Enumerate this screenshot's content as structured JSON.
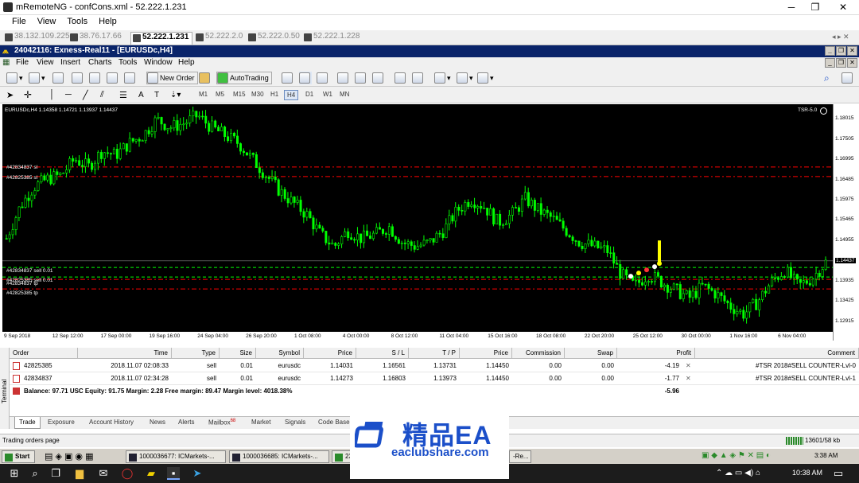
{
  "outer_window": {
    "title": "mRemoteNG - confCons.xml - 52.222.1.231",
    "menu": [
      "File",
      "View",
      "Tools",
      "Help"
    ],
    "controls": [
      "─",
      "❐",
      "✕"
    ]
  },
  "connection_tabs": [
    {
      "label": "38.132.109.225",
      "active": false
    },
    {
      "label": "38.76.17.66",
      "active": false
    },
    {
      "label": "52.222.1.231",
      "active": true
    },
    {
      "label": "52.222.2.0",
      "active": false
    },
    {
      "label": "52.222.0.50",
      "active": false
    },
    {
      "label": "52.222.1.228",
      "active": false
    }
  ],
  "mt_window": {
    "title": "24042116: Exness-Real11 - [EURUSDc,H4]",
    "menu": [
      "File",
      "View",
      "Insert",
      "Charts",
      "Tools",
      "Window",
      "Help"
    ]
  },
  "toolbar": {
    "new_order": "New Order",
    "autotrading": "AutoTrading",
    "timeframes": [
      "M1",
      "M5",
      "M15",
      "M30",
      "H1",
      "H4",
      "D1",
      "W1",
      "MN"
    ],
    "active_timeframe": "H4"
  },
  "chart": {
    "header": "EURUSDc,H4  1.14358 1.14721 1.13937 1.14437",
    "indicator_label": "TSR-5.0",
    "current_price": "1.14437",
    "line_labels": [
      {
        "text": "#42834837 sl"
      },
      {
        "text": "#42825385 sl"
      },
      {
        "text": "#42834837 sell 0.01"
      },
      {
        "text": "#42825385 sell 0.01"
      },
      {
        "text": "#42834837 tp"
      },
      {
        "text": "#42825385 tp"
      }
    ]
  },
  "chart_data": {
    "type": "candlestick",
    "symbol": "EURUSDc",
    "timeframe": "H4",
    "ylim": [
      1.1265,
      1.1838
    ],
    "y_ticks": [
      "1.18015",
      "1.17505",
      "1.16995",
      "1.16485",
      "1.15975",
      "1.15465",
      "1.14955",
      "1.14437",
      "1.13935",
      "1.13425",
      "1.12915"
    ],
    "x_ticks": [
      "9 Sep 2018",
      "12 Sep 12:00",
      "17 Sep 00:00",
      "19 Sep 16:00",
      "24 Sep 04:00",
      "26 Sep 20:00",
      "1 Oct 08:00",
      "4 Oct 00:00",
      "8 Oct 12:00",
      "11 Oct 04:00",
      "15 Oct 16:00",
      "18 Oct 08:00",
      "22 Oct 20:00",
      "25 Oct 12:00",
      "30 Oct 00:00",
      "1 Nov 16:00",
      "6 Nov 04:00"
    ],
    "close_path": [
      1.15,
      1.158,
      1.163,
      1.165,
      1.166,
      1.17,
      1.168,
      1.172,
      1.171,
      1.174,
      1.176,
      1.18,
      1.178,
      1.179,
      1.181,
      1.178,
      1.176,
      1.174,
      1.17,
      1.166,
      1.162,
      1.159,
      1.156,
      1.151,
      1.148,
      1.152,
      1.15,
      1.151,
      1.153,
      1.149,
      1.148,
      1.149,
      1.152,
      1.157,
      1.16,
      1.158,
      1.154,
      1.156,
      1.16,
      1.157,
      1.155,
      1.152,
      1.149,
      1.148,
      1.147,
      1.141,
      1.138,
      1.141,
      1.139,
      1.137,
      1.135,
      1.138,
      1.136,
      1.133,
      1.131,
      1.134,
      1.139,
      1.142,
      1.138,
      1.14,
      1.144
    ],
    "sl_levels": [
      1.168,
      1.1656
    ],
    "entry_levels": [
      1.1427,
      1.1403
    ],
    "tp_levels": [
      1.1397,
      1.1373
    ],
    "current_price": 1.14437
  },
  "terminal": {
    "side_label": "Terminal",
    "columns": [
      "Order",
      "Time",
      "Type",
      "Size",
      "Symbol",
      "Price",
      "S / L",
      "T / P",
      "Price",
      "Commission",
      "Swap",
      "Profit",
      "Comment"
    ],
    "rows": [
      {
        "order": "42825385",
        "time": "2018.11.07 02:08:33",
        "type": "sell",
        "size": "0.01",
        "symbol": "eurusdc",
        "price": "1.14031",
        "sl": "1.16561",
        "tp": "1.13731",
        "cur_price": "1.14450",
        "commission": "0.00",
        "swap": "0.00",
        "profit": "-4.19",
        "comment": "#TSR 2018#SELL COUNTER-Lvl-0"
      },
      {
        "order": "42834837",
        "time": "2018.11.07 02:34:28",
        "type": "sell",
        "size": "0.01",
        "symbol": "eurusdc",
        "price": "1.14273",
        "sl": "1.16803",
        "tp": "1.13973",
        "cur_price": "1.14450",
        "commission": "0.00",
        "swap": "0.00",
        "profit": "-1.77",
        "comment": "#TSR 2018#SELL COUNTER-Lvl-1"
      }
    ],
    "balance_line": "Balance: 97.71 USC  Equity: 91.75  Margin: 2.28  Free margin: 89.47  Margin level: 4018.38%",
    "total_profit": "-5.96",
    "tabs": [
      "Trade",
      "Exposure",
      "Account History",
      "News",
      "Alerts",
      "Mailbox",
      "Market",
      "Signals",
      "Code Base"
    ],
    "mailbox_badge": "68",
    "active_tab": "Trade"
  },
  "status_bar": {
    "left": "Trading orders page",
    "right": "13601/58 kb"
  },
  "remote_taskbar": {
    "start": "Start",
    "items": [
      "1000036677: ICMarkets-...",
      "1000036685: ICMarkets-...",
      "23",
      "-Re..."
    ],
    "clock": "3:38 AM"
  },
  "win_taskbar": {
    "time": "10:38 AM"
  },
  "watermark": {
    "cn_text": "精品EA",
    "url": "eaclubshare.com"
  },
  "colors": {
    "chart_bg": "#000000",
    "candle": "#00ff00",
    "sl_line": "#ff0000",
    "entry_line": "#00ff00",
    "tp_line": "#ff0000",
    "title_bar": "#0a246a",
    "watermark_blue": "#1b4fc9"
  }
}
